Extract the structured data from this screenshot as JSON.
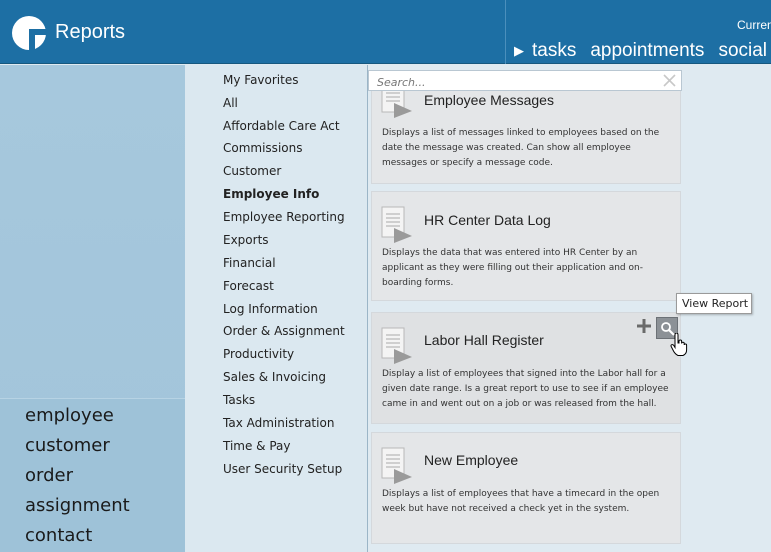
{
  "header": {
    "app_title": "Reports",
    "current_label": "Curren",
    "nav": [
      "tasks",
      "appointments",
      "social"
    ]
  },
  "modules": [
    "employee",
    "customer",
    "order",
    "assignment",
    "contact"
  ],
  "categories": [
    {
      "label": "My Favorites",
      "active": false
    },
    {
      "label": "All",
      "active": false
    },
    {
      "label": "Affordable Care Act",
      "active": false
    },
    {
      "label": "Commissions",
      "active": false
    },
    {
      "label": "Customer",
      "active": false
    },
    {
      "label": "Employee Info",
      "active": true
    },
    {
      "label": "Employee Reporting",
      "active": false
    },
    {
      "label": "Exports",
      "active": false
    },
    {
      "label": "Financial",
      "active": false
    },
    {
      "label": "Forecast",
      "active": false
    },
    {
      "label": "Log Information",
      "active": false
    },
    {
      "label": "Order & Assignment",
      "active": false
    },
    {
      "label": "Productivity",
      "active": false
    },
    {
      "label": "Sales & Invoicing",
      "active": false
    },
    {
      "label": "Tasks",
      "active": false
    },
    {
      "label": "Tax Administration",
      "active": false
    },
    {
      "label": "Time & Pay",
      "active": false
    },
    {
      "label": "User Security Setup",
      "active": false
    }
  ],
  "search": {
    "placeholder": "Search..."
  },
  "reports": [
    {
      "title": "Employee Messages",
      "description": "Displays a list of messages linked to employees based on the date the message was created.  Can show all employee messages or specify a message code."
    },
    {
      "title": "HR Center Data Log",
      "description": "Displays the data that was entered into HR Center by an applicant as they were filling out their application and on-boarding forms."
    },
    {
      "title": "Labor Hall Register",
      "description": "Display a list of employees that signed into the Labor hall for a given date range.  Is a great report to use to see if an employee came in and went out on a job or was released from the hall."
    },
    {
      "title": "New Employee",
      "description": "Displays a list of employees that have a timecard in the open week but have not received a check yet in the system."
    }
  ],
  "tooltip": "View Report",
  "colors": {
    "header": "#1d6fa4",
    "sidebar": "#a6c8dd",
    "category_bg": "#dbe8f0",
    "card_bg": "#e4e6e8"
  },
  "icons": [
    "logo-icon",
    "play-arrow-icon",
    "clear-search-icon",
    "report-document-icon",
    "plus-icon",
    "magnifier-icon",
    "hand-cursor-icon"
  ]
}
